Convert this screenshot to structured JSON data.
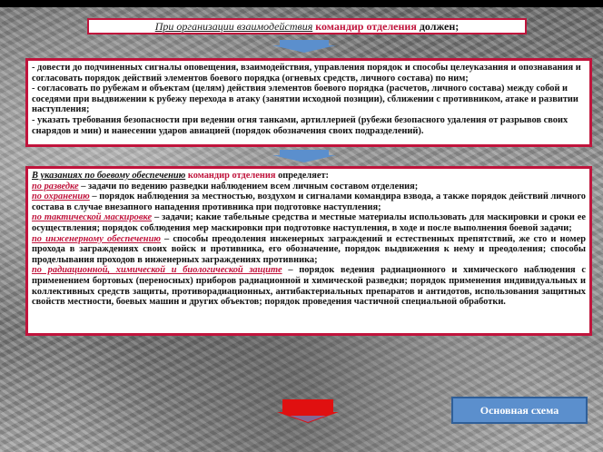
{
  "title": {
    "part1": "При организации взаимодействия",
    "part2": "командир отделения",
    "part3": "должен;"
  },
  "panel1": {
    "lines": [
      "- довести до подчиненных сигналы оповещения, взаимодействия, управления порядок и способы целеуказания и опознавания и согласовать порядок действий элементов боевого порядка (огневых средств, личного состава) по ним;",
      "- согласовать по рубежам и объектам (целям) действия элементов боевого порядка (расчетов, личного состава) между собой и соседями при выдвижении к рубежу перехода в атаку (занятии исходной позиции), сближении с противником, атаке и развитии наступления;",
      "- указать требования безопасности при ведении огня танками, артиллерией (рубежи безопасного удаления от разрывов своих снарядов и мин) и нанесении ударов авиацией (порядок обозначения своих подразделений)."
    ]
  },
  "panel2": {
    "intro1": "В указаниях по боевому обеспечению",
    "intro2": "командир отделения",
    "intro3": "определяет:",
    "items": [
      {
        "label": "по разведке",
        "text": " – задачи по ведению разведки наблюдением всем личным составом отделения;"
      },
      {
        "label": "по охранению",
        "text": " – порядок наблюдения за местностью, воздухом и сигналами командира взвода, а также порядок действий личного состава в случае внезапного нападения противника при подготовке наступления;"
      },
      {
        "label": "по тактической маскировке",
        "text": " – задачи; какие табельные средства и местные материалы использовать для маскировки и сроки ее осуществления; порядок соблюдения мер маскировки при подготовке наступления, в ходе и после выполнения боевой задачи;"
      },
      {
        "label": "по инженерному обеспечению",
        "text": " – способы преодоления инженерных заграждений и естественных препятствий, же сто и номер прохода в заграждениях своих войск и противника, его обозначение, порядок выдвижения к нему и преодоления; способы проделывания проходов в инженерных заграждениях противника;"
      },
      {
        "label": "по радиационной, химической и биологической защите",
        "text": " – порядок ведения радиационного и химического наблюдения с применением бортовых (переносных) приборов радиационной и химической разведки; порядок применения индивидуальных и коллективных средств защиты, противорадиационных, антибактериальных препаратов и антидотов, использования защитных свойств местности, боевых машин и других объектов; порядок проведения частичной специальной обработки."
      }
    ]
  },
  "main_button": {
    "label": "Основная схема"
  },
  "colors": {
    "accent": "#c0143c",
    "button": "#5b8fcd"
  }
}
